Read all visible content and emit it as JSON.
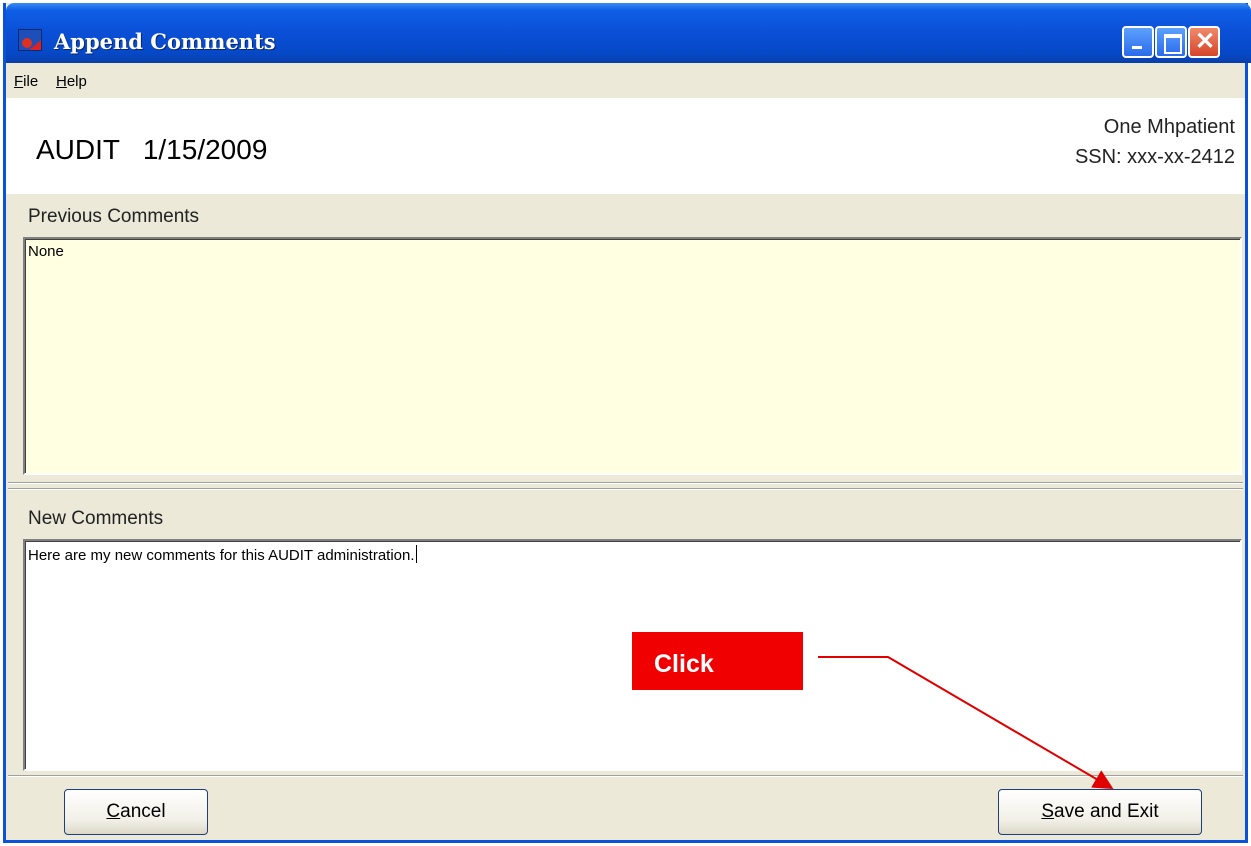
{
  "window": {
    "title": "Append Comments",
    "buttons": [
      "minimize",
      "maximize",
      "close"
    ]
  },
  "menu": {
    "file_prefix": "F",
    "file_rest": "ile",
    "help_prefix": "H",
    "help_rest": "elp"
  },
  "header": {
    "title": "AUDIT   1/15/2009",
    "patient_name": "One Mhpatient",
    "patient_ssn": "SSN: xxx-xx-2412"
  },
  "previous": {
    "label": "Previous Comments",
    "text": "None",
    "background": "#FFFFE1"
  },
  "new_comments": {
    "label": "New Comments",
    "text": "Here are my new comments for this AUDIT administration."
  },
  "buttons": {
    "cancel_prefix": "C",
    "cancel_rest": "ancel",
    "save_prefix": "S",
    "save_rest": "ave and Exit"
  },
  "annotation": {
    "label": "Click",
    "color": "#F00000"
  }
}
